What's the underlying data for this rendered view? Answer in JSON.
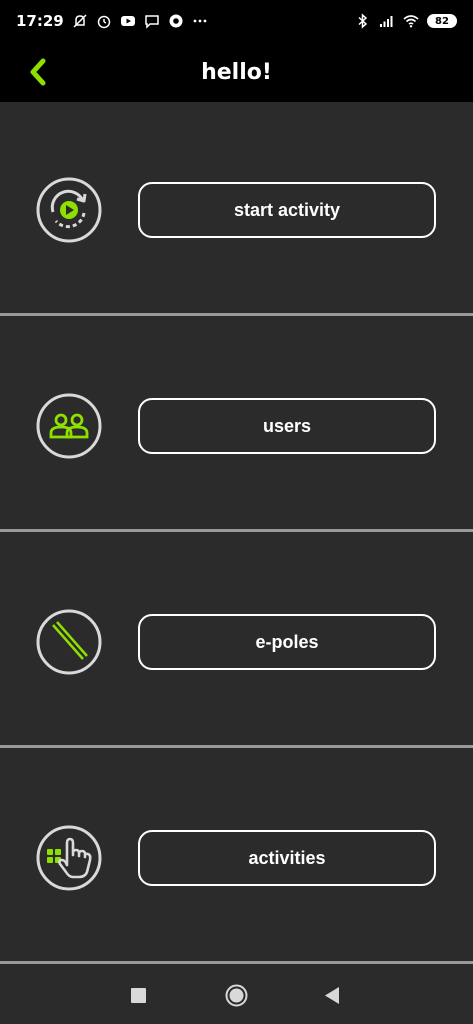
{
  "status_bar": {
    "time": "17:29",
    "battery": "82",
    "icons": [
      "mute-icon",
      "alarm-icon",
      "youtube-icon",
      "chat-icon",
      "chrome-icon",
      "more-dots-icon",
      "bluetooth-icon",
      "signal-icon",
      "wifi-icon",
      "battery-icon"
    ]
  },
  "header": {
    "title": "hello!",
    "accent_color": "#8ee000"
  },
  "menu": [
    {
      "label": "start activity",
      "icon": "play-refresh-icon"
    },
    {
      "label": "users",
      "icon": "users-icon"
    },
    {
      "label": "e-poles",
      "icon": "poles-icon"
    },
    {
      "label": "activities",
      "icon": "activities-hand-icon"
    }
  ],
  "nav_bar": {
    "icons": [
      "recents-icon",
      "home-icon",
      "back-icon"
    ]
  },
  "colors": {
    "background": "#2b2b2b",
    "bar": "#000000",
    "accent": "#8ee000",
    "divider": "#9a9a9a"
  }
}
